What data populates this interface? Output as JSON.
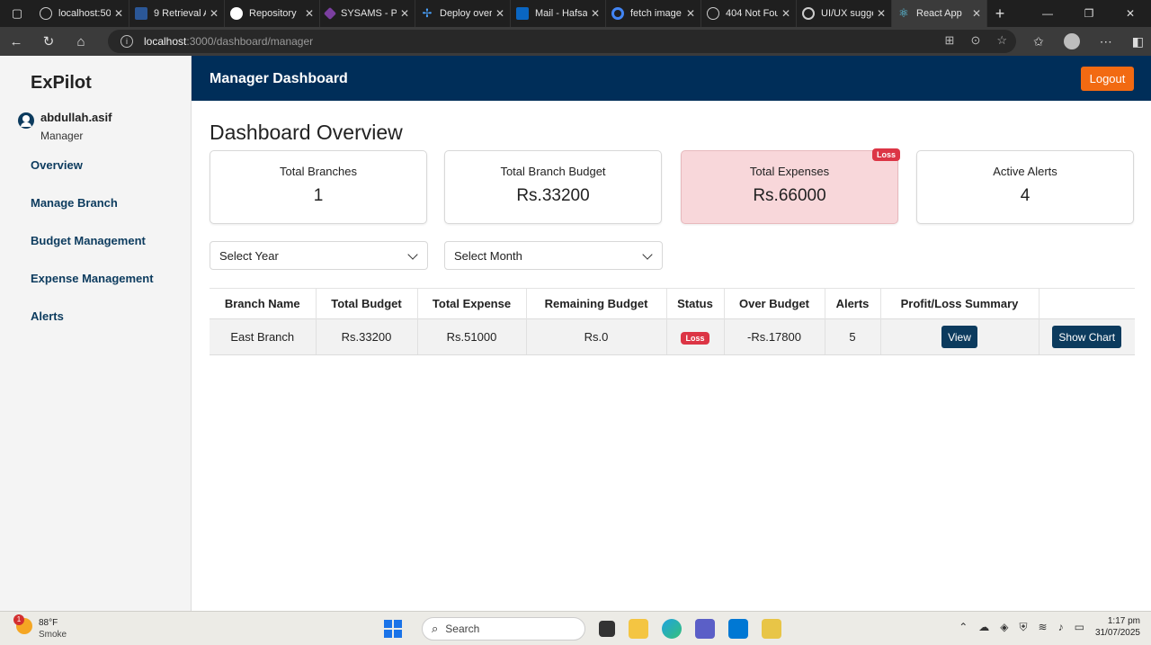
{
  "browser": {
    "tabs": [
      {
        "label": "localhost:50",
        "color": "#555"
      },
      {
        "label": "9 Retrieval A",
        "color": "#2b5797"
      },
      {
        "label": "Repository",
        "color": "#444"
      },
      {
        "label": "SYSAMS - P",
        "color": "#7b3fa0"
      },
      {
        "label": "Deploy over",
        "color": "#1f6feb"
      },
      {
        "label": "Mail - Hafsa",
        "color": "#0a66c2"
      },
      {
        "label": "fetch image",
        "color": "#4285f4"
      },
      {
        "label": "404 Not Fou",
        "color": "#555"
      },
      {
        "label": "UI/UX sugge",
        "color": "#444"
      },
      {
        "label": "React App",
        "color": "#61dafb"
      }
    ],
    "url_host": "localhost",
    "url_path": ":3000/dashboard/manager"
  },
  "sidebar": {
    "logo": "ExPilot",
    "username": "abdullah.asif",
    "role": "Manager",
    "items": [
      {
        "label": "Overview"
      },
      {
        "label": "Manage Branch"
      },
      {
        "label": "Budget Management"
      },
      {
        "label": "Expense Management"
      },
      {
        "label": "Alerts"
      }
    ]
  },
  "header": {
    "title": "Manager Dashboard",
    "logout_label": "Logout"
  },
  "main": {
    "title": "Dashboard Overview",
    "cards": [
      {
        "label": "Total Branches",
        "value": "1"
      },
      {
        "label": "Total Branch Budget",
        "value": "Rs.33200"
      },
      {
        "label": "Total Expenses",
        "value": "Rs.66000",
        "badge": "Loss"
      },
      {
        "label": "Active Alerts",
        "value": "4"
      }
    ],
    "year_select": "Select Year",
    "month_select": "Select Month",
    "table": {
      "headers": [
        "Branch Name",
        "Total Budget",
        "Total Expense",
        "Remaining Budget",
        "Status",
        "Over Budget",
        "Alerts",
        "Profit/Loss Summary",
        ""
      ],
      "rows": [
        {
          "branch": "East Branch",
          "budget": "Rs.33200",
          "expense": "Rs.51000",
          "remaining": "Rs.0",
          "status": "Loss",
          "over": "-Rs.17800",
          "alerts": "5",
          "view_label": "View",
          "chart_label": "Show Chart"
        }
      ]
    }
  },
  "taskbar": {
    "temp": "88°F",
    "weather": "Smoke",
    "weather_badge": "1",
    "search": "Search",
    "time": "1:17 pm",
    "date": "31/07/2025"
  },
  "colors": {
    "nav": "#002e59",
    "accent": "#f26a12",
    "loss": "#dc3545",
    "button": "#0c3b5e"
  }
}
